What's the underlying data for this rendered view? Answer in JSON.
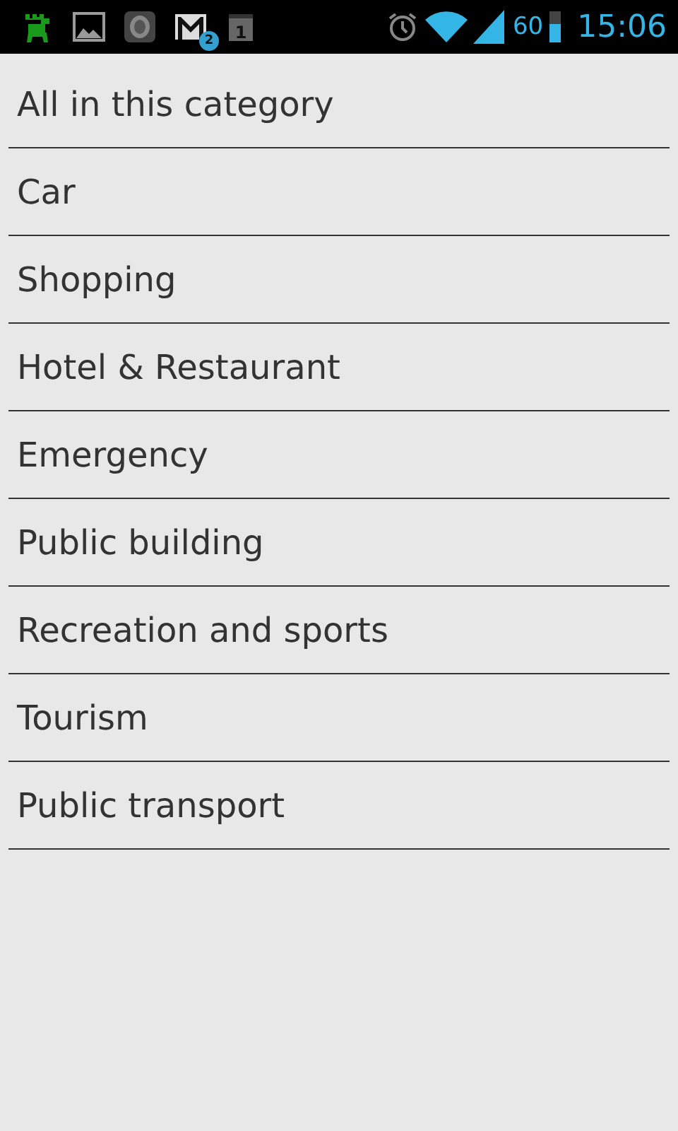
{
  "status_bar": {
    "mail_badge": "2",
    "calendar_day": "1",
    "battery_text": "60",
    "battery": {
      "level": 0.6
    },
    "time": "15:06"
  },
  "categories": [
    {
      "label": "All in this category"
    },
    {
      "label": "Car"
    },
    {
      "label": "Shopping"
    },
    {
      "label": "Hotel & Restaurant"
    },
    {
      "label": "Emergency"
    },
    {
      "label": "Public building"
    },
    {
      "label": "Recreation and sports"
    },
    {
      "label": "Tourism"
    },
    {
      "label": "Public transport"
    }
  ]
}
